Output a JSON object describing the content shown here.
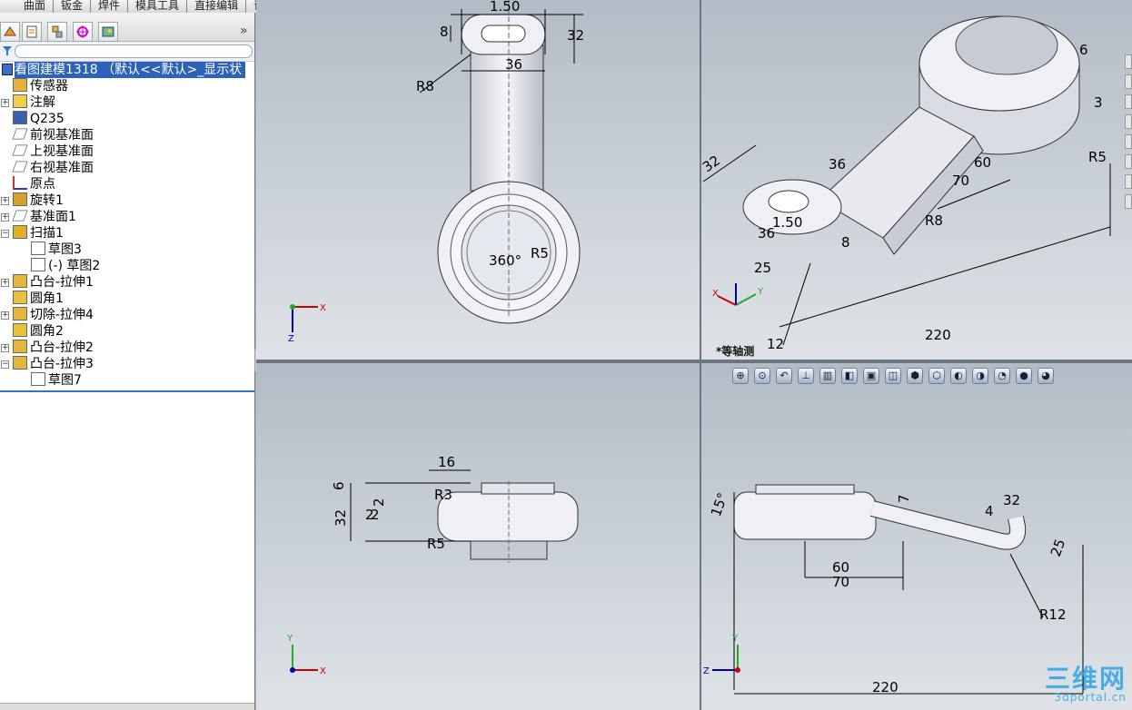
{
  "command_tabs": [
    "曲面",
    "钣金",
    "焊件",
    "模具工具",
    "直接编辑",
    "评估"
  ],
  "feature_tree": {
    "root": "看图建模1318 （默认<<默认>_显示状",
    "items": [
      {
        "label": "传感器",
        "icon": "sensor-icon",
        "expandable": false,
        "indent": 1
      },
      {
        "label": "注解",
        "icon": "annotation-icon",
        "expandable": true,
        "indent": 1
      },
      {
        "label": "Q235",
        "icon": "material-icon",
        "expandable": false,
        "indent": 1
      },
      {
        "label": "前视基准面",
        "icon": "plane-icon",
        "expandable": false,
        "indent": 1
      },
      {
        "label": "上视基准面",
        "icon": "plane-icon",
        "expandable": false,
        "indent": 1
      },
      {
        "label": "右视基准面",
        "icon": "plane-icon",
        "expandable": false,
        "indent": 1
      },
      {
        "label": "原点",
        "icon": "origin-icon",
        "expandable": false,
        "indent": 1
      },
      {
        "label": "旋转1",
        "icon": "revolve-icon",
        "expandable": true,
        "indent": 1
      },
      {
        "label": "基准面1",
        "icon": "plane-icon",
        "expandable": true,
        "indent": 1
      },
      {
        "label": "扫描1",
        "icon": "sweep-icon",
        "expandable": true,
        "expanded": true,
        "indent": 1
      },
      {
        "label": "草图3",
        "icon": "sketch-icon",
        "expandable": false,
        "indent": 2
      },
      {
        "label": "(-) 草图2",
        "icon": "sketch-icon",
        "expandable": false,
        "indent": 2
      },
      {
        "label": "凸台-拉伸1",
        "icon": "extrude-icon",
        "expandable": true,
        "indent": 1
      },
      {
        "label": "圆角1",
        "icon": "fillet-icon",
        "expandable": false,
        "indent": 1
      },
      {
        "label": "切除-拉伸4",
        "icon": "cut-extrude-icon",
        "expandable": true,
        "indent": 1
      },
      {
        "label": "圆角2",
        "icon": "fillet-icon",
        "expandable": false,
        "indent": 1
      },
      {
        "label": "凸台-拉伸2",
        "icon": "extrude-icon",
        "expandable": true,
        "indent": 1
      },
      {
        "label": "凸台-拉伸3",
        "icon": "extrude-icon",
        "expandable": true,
        "expanded": true,
        "indent": 1
      },
      {
        "label": "草图7",
        "icon": "sketch-icon",
        "expandable": false,
        "indent": 2
      }
    ]
  },
  "viewports": {
    "front": {
      "dims": [
        "1.50",
        "8",
        "32",
        "36",
        "R8",
        "360°",
        "R5"
      ]
    },
    "iso": {
      "label": "*等轴测",
      "dims": [
        "32",
        "36",
        "60",
        "70",
        "R5",
        "R8",
        "8",
        "1.50",
        "36",
        "25",
        "12",
        "220",
        "6",
        "3"
      ]
    },
    "top": {
      "dims": [
        "16",
        "6",
        "2",
        "2",
        "32",
        "2",
        "R3",
        "R5"
      ]
    },
    "right": {
      "dims": [
        "15°",
        "7",
        "32",
        "4",
        "25",
        "60",
        "70",
        "R12",
        "220"
      ]
    }
  },
  "axes": {
    "x": "X",
    "y": "Y",
    "z": "Z"
  },
  "watermark": {
    "big": "三维网",
    "small": "3dportal.cn"
  },
  "colors": {
    "viewport_bg_top": "#b3bcc6",
    "viewport_bg_bottom": "#dfe3e8",
    "tree_selected": "#2c62b8",
    "dimension_text": "#000000",
    "model_face": "#e9ebf2"
  }
}
